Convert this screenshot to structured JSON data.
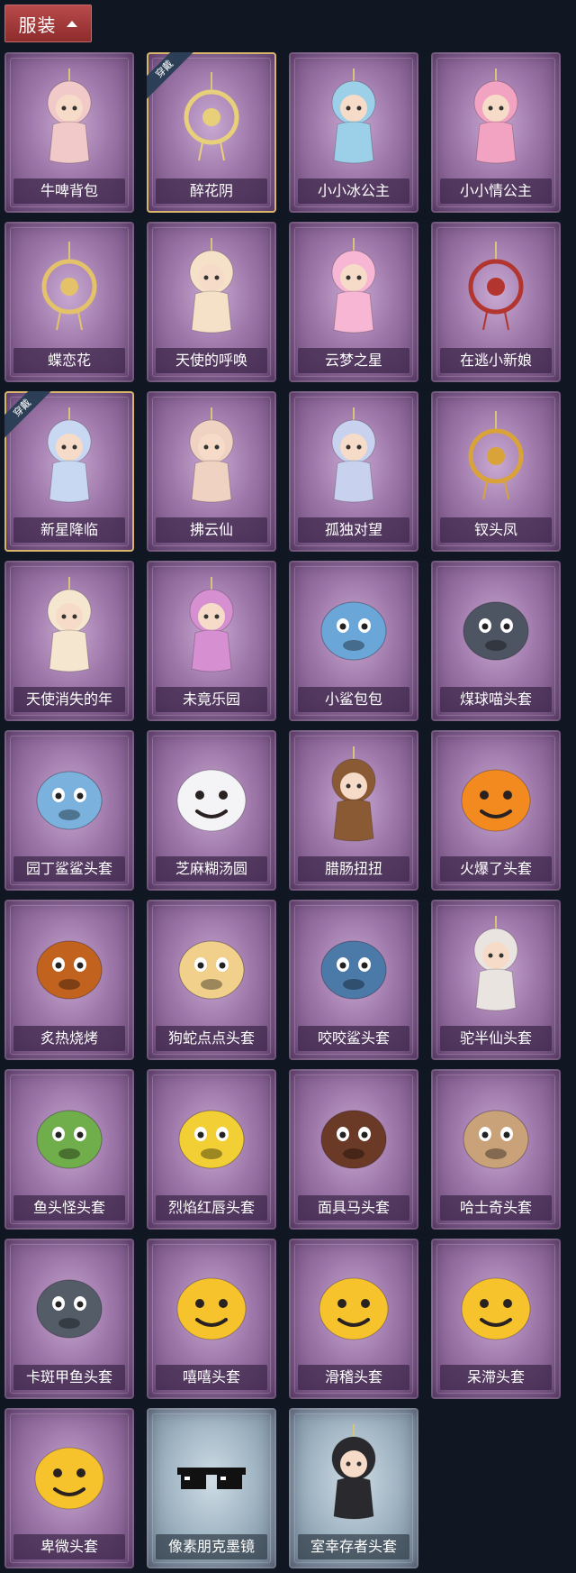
{
  "header": {
    "title": "服装",
    "chevron_icon": "chevron-up-icon"
  },
  "equipped_badge": "穿戴",
  "items": [
    {
      "label": "牛啤背包",
      "icon": "beer-barrel-pig",
      "color": "#f2c9c9",
      "equipped": false,
      "frame": "purple"
    },
    {
      "label": "醉花阴",
      "icon": "floral-pendant",
      "color": "#e8cf7a",
      "equipped": true,
      "frame": "purple"
    },
    {
      "label": "小小冰公主",
      "icon": "ice-princess",
      "color": "#9ccfe8",
      "equipped": false,
      "frame": "purple"
    },
    {
      "label": "小小情公主",
      "icon": "pink-princess",
      "color": "#f3a3c2",
      "equipped": false,
      "frame": "purple"
    },
    {
      "label": "蝶恋花",
      "icon": "bell-pendant",
      "color": "#e3c26a",
      "equipped": false,
      "frame": "purple"
    },
    {
      "label": "天使的呼唤",
      "icon": "angel-doll",
      "color": "#f5e1c8",
      "equipped": false,
      "frame": "purple"
    },
    {
      "label": "云梦之星",
      "icon": "unicorn-cloud",
      "color": "#f7b6d3",
      "equipped": false,
      "frame": "purple"
    },
    {
      "label": "在逃小新娘",
      "icon": "bride-lamp",
      "color": "#b3352f",
      "equipped": false,
      "frame": "purple"
    },
    {
      "label": "新星降临",
      "icon": "star-doll",
      "color": "#c9d8f2",
      "equipped": true,
      "frame": "purple"
    },
    {
      "label": "拂云仙",
      "icon": "cloud-fairy",
      "color": "#f0d2c2",
      "equipped": false,
      "frame": "purple"
    },
    {
      "label": "孤独对望",
      "icon": "lonely-doll",
      "color": "#c8d2ee",
      "equipped": false,
      "frame": "purple"
    },
    {
      "label": "钗头凤",
      "icon": "phoenix-crown",
      "color": "#d9a33a",
      "equipped": false,
      "frame": "purple"
    },
    {
      "label": "天使消失的年",
      "icon": "veiled-angel",
      "color": "#f5e6cf",
      "equipped": false,
      "frame": "purple"
    },
    {
      "label": "未竟乐园",
      "icon": "paradise-girl",
      "color": "#d68fd1",
      "equipped": false,
      "frame": "purple"
    },
    {
      "label": "小鲨包包",
      "icon": "shark-bag",
      "color": "#6aa7d8",
      "equipped": false,
      "frame": "purple"
    },
    {
      "label": "煤球喵头套",
      "icon": "cat-head",
      "color": "#4d5563",
      "equipped": false,
      "frame": "purple"
    },
    {
      "label": "园丁鲨鲨头套",
      "icon": "gardener-shark",
      "color": "#7ab2dd",
      "equipped": false,
      "frame": "purple"
    },
    {
      "label": "芝麻糊汤圆",
      "icon": "rice-ball",
      "color": "#f4f4f7",
      "equipped": false,
      "frame": "purple"
    },
    {
      "label": "腊肠扭扭",
      "icon": "sausage-dog",
      "color": "#8a5a34",
      "equipped": false,
      "frame": "purple"
    },
    {
      "label": "火爆了头套",
      "icon": "fire-head",
      "color": "#f28a1f",
      "equipped": false,
      "frame": "purple"
    },
    {
      "label": "炙热烧烤",
      "icon": "bbq-meat",
      "color": "#c2621f",
      "equipped": false,
      "frame": "purple"
    },
    {
      "label": "狗蛇点点头套",
      "icon": "snake-head",
      "color": "#f0d08a",
      "equipped": false,
      "frame": "purple"
    },
    {
      "label": "咬咬鲨头套",
      "icon": "biting-shark",
      "color": "#4b79a8",
      "equipped": false,
      "frame": "purple"
    },
    {
      "label": "驼半仙头套",
      "icon": "bear-sunglasses",
      "color": "#e9e4df",
      "equipped": false,
      "frame": "purple"
    },
    {
      "label": "鱼头怪头套",
      "icon": "fish-head",
      "color": "#6fae4a",
      "equipped": false,
      "frame": "purple"
    },
    {
      "label": "烈焰红唇头套",
      "icon": "yellow-mouse",
      "color": "#f2cf34",
      "equipped": false,
      "frame": "purple"
    },
    {
      "label": "面具马头套",
      "icon": "horse-head",
      "color": "#6b3a26",
      "equipped": false,
      "frame": "purple"
    },
    {
      "label": "哈士奇头套",
      "icon": "husky-head",
      "color": "#caa27a",
      "equipped": false,
      "frame": "purple"
    },
    {
      "label": "卡斑甲鱼头套",
      "icon": "seal-head",
      "color": "#545c68",
      "equipped": false,
      "frame": "purple"
    },
    {
      "label": "嘻嘻头套",
      "icon": "grin-emoji",
      "color": "#f7c32c",
      "equipped": false,
      "frame": "purple"
    },
    {
      "label": "滑稽头套",
      "icon": "funny-emoji",
      "color": "#f7c32c",
      "equipped": false,
      "frame": "purple"
    },
    {
      "label": "呆滞头套",
      "icon": "dazed-emoji",
      "color": "#f7c32c",
      "equipped": false,
      "frame": "purple"
    },
    {
      "label": "卑微头套",
      "icon": "humble-emoji",
      "color": "#f7c32c",
      "equipped": false,
      "frame": "purple"
    },
    {
      "label": "像素朋克墨镜",
      "icon": "pixel-sunglasses",
      "color": "#111111",
      "equipped": false,
      "frame": "blue"
    },
    {
      "label": "室幸存者头套",
      "icon": "gas-mask-helmet",
      "color": "#2a2a2e",
      "equipped": false,
      "frame": "blue"
    }
  ]
}
